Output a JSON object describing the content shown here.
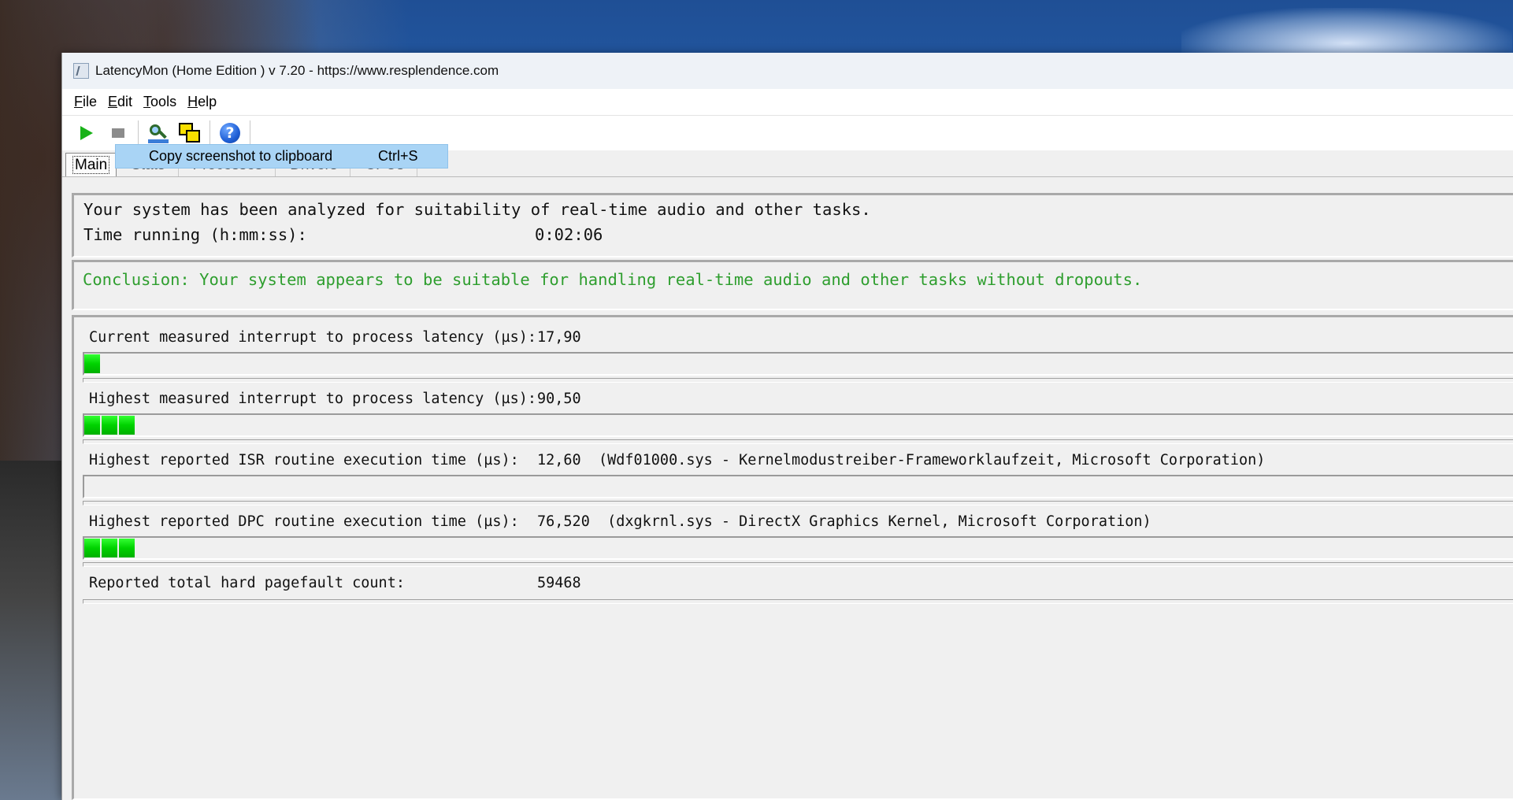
{
  "window": {
    "title": "LatencyMon  (Home Edition )  v 7.20 - https://www.resplendence.com"
  },
  "menu": {
    "items": [
      {
        "first": "F",
        "rest": "ile"
      },
      {
        "first": "E",
        "rest": "dit"
      },
      {
        "first": "T",
        "rest": "ools"
      },
      {
        "first": "H",
        "rest": "elp"
      }
    ]
  },
  "toolbar": {
    "icons": [
      "play-icon",
      "stop-icon",
      "tools-icon",
      "copy-screenshot-icon",
      "help-icon"
    ],
    "help_glyph": "?"
  },
  "tooltip": {
    "label": "Copy screenshot to clipboard",
    "shortcut": "Ctrl+S"
  },
  "tabs": [
    {
      "label": "Main",
      "active": true
    },
    {
      "label": "Stats"
    },
    {
      "label": "Processes"
    },
    {
      "label": "Drivers"
    },
    {
      "label": "CPUs"
    }
  ],
  "summary": {
    "analyzed": "Your system has been analyzed for suitability of real-time audio and other tasks.",
    "time_label": "Time running (h:mm:ss):",
    "time_value": "0:02:06"
  },
  "conclusion": {
    "text": "Conclusion: Your system appears to be suitable for handling real-time audio and other tasks without dropouts."
  },
  "metrics": [
    {
      "label": "Current measured interrupt to process latency (µs):",
      "value": "17,90",
      "bar_segments": 1
    },
    {
      "label": "Highest measured interrupt to process latency (µs):",
      "value": "90,50",
      "bar_segments": 3
    },
    {
      "label": "Highest reported ISR routine execution time (µs):",
      "value": "12,60  (Wdf01000.sys - Kernelmodustreiber-Frameworklaufzeit, Microsoft Corporation)",
      "bar_segments": 0
    },
    {
      "label": "Highest reported DPC routine execution time (µs):",
      "value": "76,520  (dxgkrnl.sys - DirectX Graphics Kernel, Microsoft Corporation)",
      "bar_segments": 3
    },
    {
      "label": "Reported total hard pagefault count:",
      "value": "59468"
    }
  ],
  "colors": {
    "conclusion_green": "#2e9e2e",
    "bar_green": "#00d200",
    "tooltip_bg": "#a9d4f5"
  }
}
